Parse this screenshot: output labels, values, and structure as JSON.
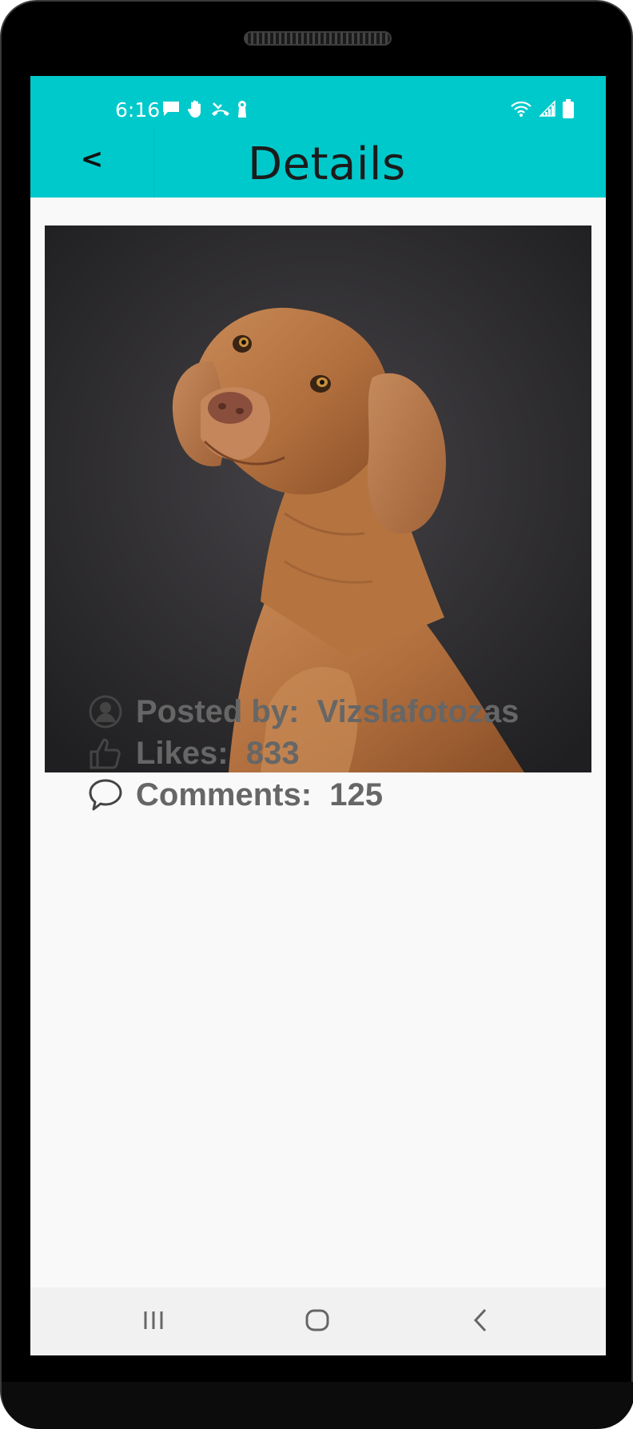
{
  "status_bar": {
    "time": "6:16",
    "left_icons": [
      "message-icon",
      "hand-icon",
      "missed-call-icon",
      "keyhole-icon"
    ],
    "right_icons": [
      "wifi-icon",
      "signal-icon",
      "battery-icon"
    ]
  },
  "app_bar": {
    "back_label": "<",
    "title": "Details",
    "background_color": "#00c9cc"
  },
  "post": {
    "image_subject": "brown vizsla dog portrait",
    "posted_by_label": "Posted by:",
    "posted_by_value": "Vizslafotozas",
    "likes_label": "Likes:",
    "likes_value": "833",
    "comments_label": "Comments:",
    "comments_value": "125"
  },
  "nav_bar": {
    "buttons": [
      "recent-apps-icon",
      "home-icon",
      "back-icon"
    ]
  }
}
